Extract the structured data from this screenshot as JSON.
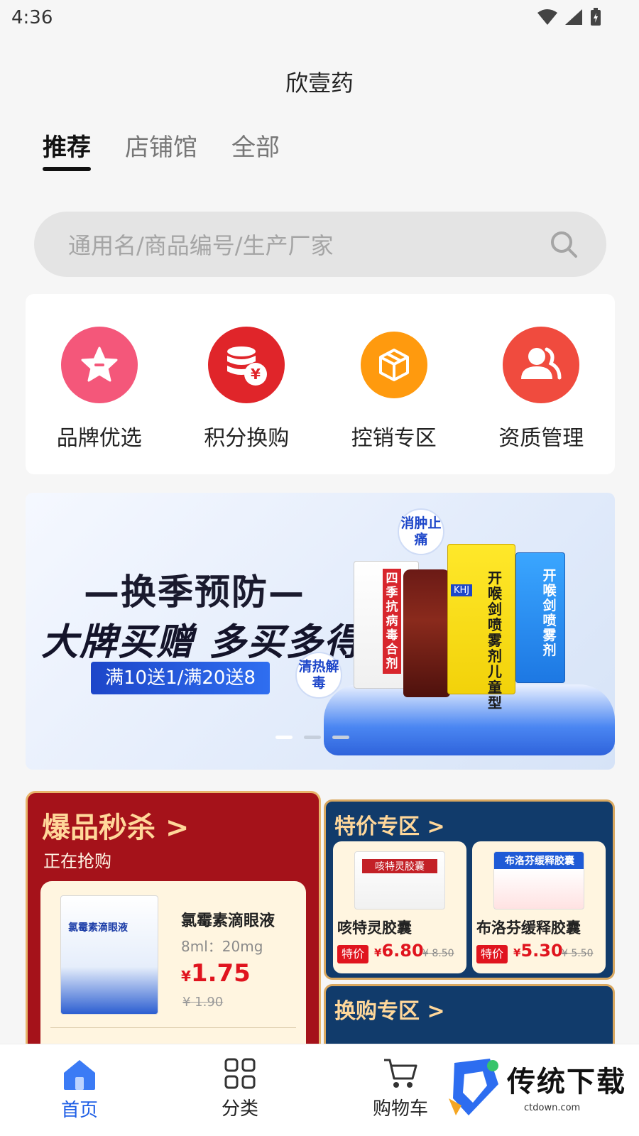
{
  "status_bar": {
    "time": "4:36"
  },
  "app": {
    "title": "欣壹药"
  },
  "tabs": [
    {
      "label": "推荐",
      "active": true
    },
    {
      "label": "店铺馆",
      "active": false
    },
    {
      "label": "全部",
      "active": false
    }
  ],
  "search": {
    "placeholder": "通用名/商品编号/生产厂家"
  },
  "quick_actions": [
    {
      "label": "品牌优选",
      "icon": "star-icon",
      "color": "#f4577a"
    },
    {
      "label": "积分换购",
      "icon": "coins-yuan-icon",
      "color": "#e0252a"
    },
    {
      "label": "控销专区",
      "icon": "package-box-icon",
      "color": "#ff9a0e"
    },
    {
      "label": "资质管理",
      "icon": "users-icon",
      "color": "#f04b3e"
    }
  ],
  "banner": {
    "headline": "—换季预防—",
    "slogan": "大牌买赠  多买多得",
    "promo": "满10送1/满20送8",
    "badge_top": "消肿止痛",
    "badge_bottom": "清热解毒",
    "product_left": "四季抗病毒合剂",
    "product_right": "开喉剑喷雾剂",
    "product_right_kid": "开喉剑喷雾剂儿童型",
    "brand_badge": "KHJ",
    "slide_count": 3,
    "active_slide": 0
  },
  "flash_sale": {
    "title": "爆品秒杀 >",
    "subtitle": "正在抢购",
    "product": {
      "box_text": "氯霉素滴眼液",
      "name": "氯霉素滴眼液",
      "spec": "8ml：20mg",
      "currency": "¥",
      "price": "1.75",
      "original_price": "¥ 1.90"
    }
  },
  "special_zone": {
    "title": "特价专区 >",
    "tag": "特价",
    "items": [
      {
        "name": "咳特灵胶囊",
        "img_text": "咳特灵胶囊",
        "currency": "¥",
        "price": "6.80",
        "original_price": "¥ 8.50"
      },
      {
        "name": "布洛芬缓释胶囊",
        "img_text": "布洛芬缓释胶囊",
        "currency": "¥",
        "price": "5.30",
        "original_price": "¥ 5.50"
      }
    ]
  },
  "exchange_zone": {
    "title": "换购专区 >"
  },
  "bottom_nav": [
    {
      "label": "首页",
      "icon": "home-icon",
      "active": true
    },
    {
      "label": "分类",
      "icon": "grid-icon",
      "active": false
    },
    {
      "label": "购物车",
      "icon": "cart-icon",
      "active": false
    }
  ],
  "watermark": {
    "text": "传统下载",
    "url": "ctdown.com"
  },
  "colors": {
    "accent": "#1f5fe6",
    "price_red": "#e0141e",
    "flash_red": "#a5121a",
    "panel_navy": "#113b6b",
    "gold": "#ffd79a"
  }
}
